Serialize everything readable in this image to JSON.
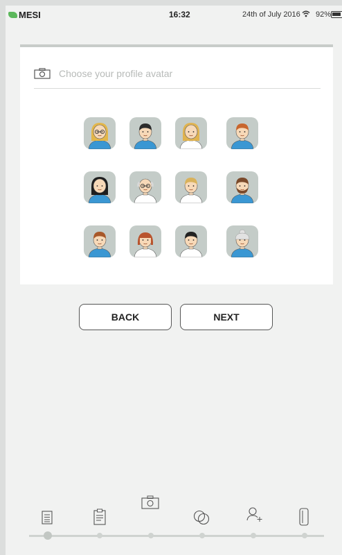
{
  "status_bar": {
    "brand": "MESI",
    "time": "16:32",
    "date": "24th of July 2016",
    "battery": "92%",
    "brand_color": "#5cb85c"
  },
  "avatar_picker": {
    "heading": "Choose your profile avatar",
    "avatars": [
      {
        "hair": "blonde-glasses",
        "gender": "female"
      },
      {
        "hair": "dark-short",
        "gender": "male"
      },
      {
        "hair": "blonde-long",
        "gender": "female"
      },
      {
        "hair": "ginger-curly",
        "gender": "male"
      },
      {
        "hair": "black-long",
        "gender": "female"
      },
      {
        "hair": "bald-glasses",
        "gender": "male"
      },
      {
        "hair": "blonde-short",
        "gender": "male"
      },
      {
        "hair": "brown-beard",
        "gender": "male"
      },
      {
        "hair": "brown-short",
        "gender": "male"
      },
      {
        "hair": "red-bob",
        "gender": "female"
      },
      {
        "hair": "black-short",
        "gender": "male"
      },
      {
        "hair": "gray-bun",
        "gender": "female"
      }
    ]
  },
  "buttons": {
    "back": "BACK",
    "next": "NEXT"
  },
  "steps": {
    "icons": [
      "document-icon",
      "clipboard-icon",
      "camera-icon",
      "circles-icon",
      "add-user-icon",
      "cylinder-icon"
    ],
    "current": 3
  },
  "colors": {
    "avatar_bg": "#c4ccc8",
    "shirt": "#3a97d3",
    "skin": "#f7d9b8"
  }
}
